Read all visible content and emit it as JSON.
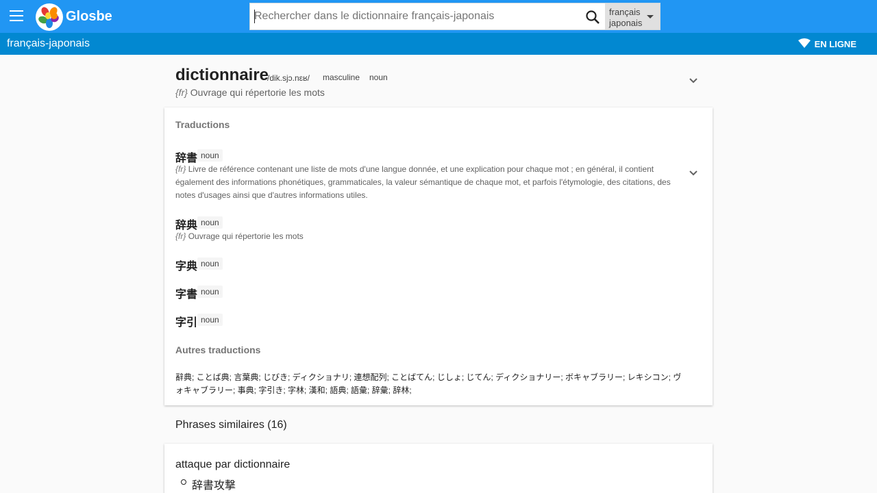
{
  "header": {
    "brand": "Glosbe",
    "search_placeholder": "Rechercher dans le dictionnaire français-japonais",
    "lang_select": {
      "line1": "français",
      "line2": "japonais"
    }
  },
  "subbar": {
    "language_pair": "français-japonais",
    "status": "EN LIGNE"
  },
  "entry": {
    "word": "dictionnaire",
    "pronunciation": "/dik.sjɔ.nɛʁ/",
    "gender": "masculine",
    "pos": "noun",
    "lang_code": "{fr}",
    "definition": "Ouvrage qui répertorie les mots"
  },
  "translations": {
    "title": "Traductions",
    "items": [
      {
        "word": "辞書",
        "pos": "noun",
        "lang_code": "{fr}",
        "definition": "Livre de référence contenant une liste de mots d'une langue donnée, et une explication pour chaque mot ; en général, il contient également des informations phonétiques, grammaticales, la valeur sémantique de chaque mot, et parfois l'étymologie, des citations, des notes d'usages ainsi que d'autres informations utiles."
      },
      {
        "word": "辞典",
        "pos": "noun",
        "lang_code": "{fr}",
        "definition": "Ouvrage qui répertorie les mots"
      },
      {
        "word": "字典",
        "pos": "noun"
      },
      {
        "word": "字書",
        "pos": "noun"
      },
      {
        "word": "字引",
        "pos": "noun"
      }
    ],
    "others_title": "Autres traductions",
    "others_text": "辭典; ことば典; 言葉典; じびき; ディクショナリ; 連想配列; ことばてん; じしょ; じてん; ディクショナリー; ボキャブラリー; レキシコン; ヴォキャブラリー; 事典; 字引き; 字林; 漢和; 語典; 語彙; 辞彙; 辞林;"
  },
  "similar": {
    "title": "Phrases similaires (16)",
    "items": [
      {
        "phrase": "attaque par dictionnaire",
        "translation": "辞書攻撃"
      }
    ]
  },
  "colors": {
    "primary": "#2196f3",
    "subbar": "#0288d1"
  }
}
